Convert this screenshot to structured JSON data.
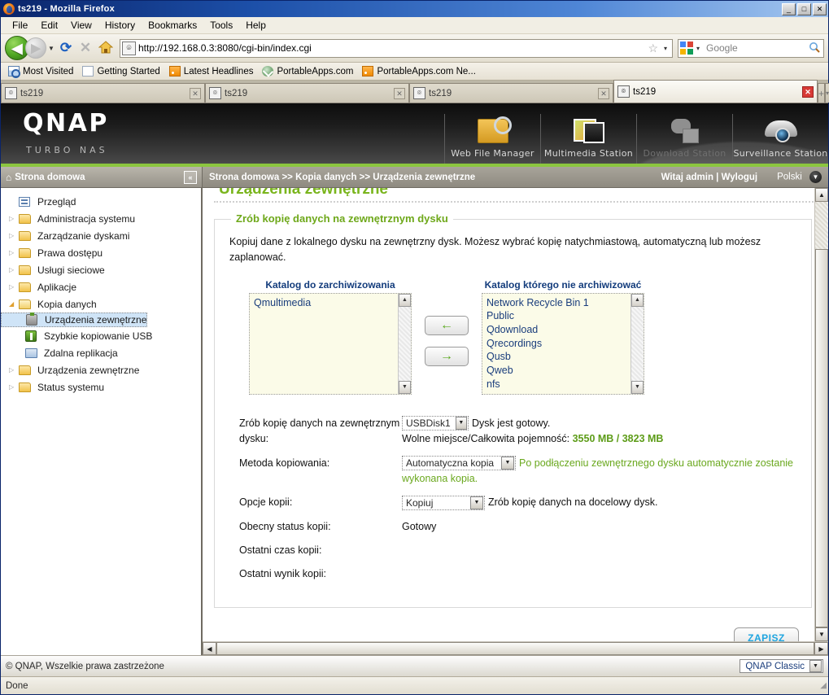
{
  "browser": {
    "title": "ts219 - Mozilla Firefox",
    "window_buttons": {
      "minimize": "_",
      "maximize": "□",
      "close": "✕"
    },
    "menus": [
      "File",
      "Edit",
      "View",
      "History",
      "Bookmarks",
      "Tools",
      "Help"
    ],
    "toolbar": {
      "back": "◀",
      "forward": "▶",
      "dropdown_caret": "▼",
      "reload": "⟳",
      "stop": "✕",
      "home": "⌂",
      "url": "http://192.168.0.3:8080/cgi-bin/index.cgi",
      "url_favicon": "⌾",
      "bookmark_star": "☆",
      "star_caret": "▾",
      "search_placeholder": "Google",
      "search_engine_caret": "▾",
      "search_go": "🔍"
    },
    "bookmarks": [
      {
        "label": "Most Visited",
        "icon": "most-visited-icon"
      },
      {
        "label": "Getting Started",
        "icon": "page-icon"
      },
      {
        "label": "Latest Headlines",
        "icon": "rss-icon"
      },
      {
        "label": "PortableApps.com",
        "icon": "portableapps-icon"
      },
      {
        "label": "PortableApps.com Ne...",
        "icon": "rss-icon"
      }
    ],
    "tabs": [
      {
        "label": "ts219",
        "active": false,
        "close": "✕"
      },
      {
        "label": "ts219",
        "active": false,
        "close": "✕"
      },
      {
        "label": "ts219",
        "active": false,
        "close": "✕"
      },
      {
        "label": "ts219",
        "active": true,
        "close": "✕"
      }
    ],
    "new_tab": "+",
    "tab_list": "▾",
    "status": "Done"
  },
  "qnap": {
    "logo": "QNAP",
    "logo_sub": "TURBO NAS",
    "apps": [
      {
        "label": "Web File Manager",
        "icon": "web-file-manager-icon",
        "dim": false
      },
      {
        "label": "Multimedia Station",
        "icon": "multimedia-station-icon",
        "dim": false
      },
      {
        "label": "Download Station",
        "icon": "download-station-icon",
        "dim": true
      },
      {
        "label": "Surveillance Station",
        "icon": "surveillance-station-icon",
        "dim": false
      }
    ],
    "accent_green": "#8cc63f",
    "title_green": "#7ab51d"
  },
  "crumbbar": {
    "home_label": "Strona domowa",
    "home_icon": "home-icon",
    "collapse": "«",
    "path": "Strona domowa >> Kopia danych >> Urządzenia zewnętrzne",
    "user": "Witaj admin | Wyloguj",
    "language": "Polski",
    "language_caret": "▼"
  },
  "sidebar": {
    "items": [
      {
        "label": "Przegląd",
        "icon": "overview-icon",
        "twisty": "",
        "indent": 0,
        "selected": false
      },
      {
        "label": "Administracja systemu",
        "icon": "folder-icon",
        "twisty": "▷",
        "indent": 0,
        "selected": false
      },
      {
        "label": "Zarządzanie dyskami",
        "icon": "folder-icon",
        "twisty": "▷",
        "indent": 0,
        "selected": false
      },
      {
        "label": "Prawa dostępu",
        "icon": "folder-icon",
        "twisty": "▷",
        "indent": 0,
        "selected": false
      },
      {
        "label": "Usługi sieciowe",
        "icon": "folder-icon",
        "twisty": "▷",
        "indent": 0,
        "selected": false
      },
      {
        "label": "Aplikacje",
        "icon": "folder-icon",
        "twisty": "▷",
        "indent": 0,
        "selected": false
      },
      {
        "label": "Kopia danych",
        "icon": "folder-open-icon",
        "twisty": "◢",
        "indent": 0,
        "selected": false
      },
      {
        "label": "Urządzenia zewnętrzne",
        "icon": "usb-device-icon",
        "twisty": "",
        "indent": 1,
        "selected": true
      },
      {
        "label": "Szybkie kopiowanie USB",
        "icon": "usb-green-icon",
        "twisty": "",
        "indent": 1,
        "selected": false
      },
      {
        "label": "Zdalna replikacja",
        "icon": "replication-icon",
        "twisty": "",
        "indent": 1,
        "selected": false
      },
      {
        "label": "Urządzenia zewnętrzne",
        "icon": "folder-icon",
        "twisty": "▷",
        "indent": 0,
        "selected": false
      },
      {
        "label": "Status systemu",
        "icon": "folder-icon",
        "twisty": "▷",
        "indent": 0,
        "selected": false
      }
    ]
  },
  "main": {
    "page_title": "Urządzenia zewnętrzne",
    "legend": "Zrób kopię danych na zewnętrznym dysku",
    "intro": "Kopiuj dane z lokalnego dysku na zewnętrzny dysk. Możesz wybrać kopię natychmiastową, automatyczną lub możesz zaplanować.",
    "left_list": {
      "header": "Katalog do zarchiwizowania",
      "items": [
        "Qmultimedia"
      ],
      "scroll_up": "▲",
      "scroll_down": "▼"
    },
    "right_list": {
      "header": "Katalog którego nie archiwizować",
      "items": [
        "Network Recycle Bin 1",
        "Public",
        "Qdownload",
        "Qrecordings",
        "Qusb",
        "Qweb",
        "nfs"
      ],
      "scroll_up": "▲",
      "scroll_down": "▼"
    },
    "move_left": "←",
    "move_right": "→",
    "fields": [
      {
        "label": "Zrób kopię danych na zewnętrznym dysku:",
        "select": "USBDisk1",
        "caret": "▼",
        "note": "Dysk jest gotowy.",
        "note_color": "normal",
        "extra_label": "Wolne miejsce/Całkowita pojemność:",
        "extra_value": "3550 MB / 3823 MB"
      },
      {
        "label": "Metoda kopiowania:",
        "select": "Automatyczna kopia",
        "caret": "▼",
        "note": "Po podłączeniu zewnętrznego dysku automatycznie zostanie wykonana kopia.",
        "note_color": "green"
      },
      {
        "label": "Opcje kopii:",
        "select": "Kopiuj",
        "caret": "▼",
        "note": "Zrób kopię danych na docelowy dysk.",
        "note_color": "normal"
      }
    ],
    "status_rows": [
      {
        "label": "Obecny status kopii:",
        "value": "Gotowy"
      },
      {
        "label": "Ostatni czas kopii:",
        "value": ""
      },
      {
        "label": "Ostatni wynik kopii:",
        "value": ""
      }
    ],
    "save_label": "ZAPISZ",
    "scroll_up": "▲",
    "scroll_down": "▼",
    "scroll_left": "◀",
    "scroll_right": "▶"
  },
  "footer": {
    "copyright": "© QNAP, Wszelkie prawa zastrzeżone",
    "theme": "QNAP Classic",
    "theme_caret": "▼"
  }
}
